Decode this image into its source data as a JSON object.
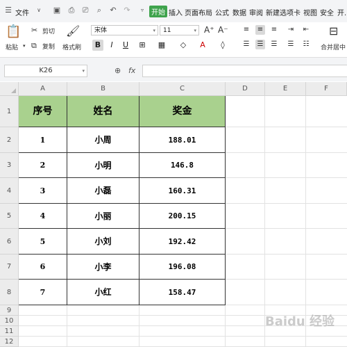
{
  "menubar": {
    "file_label": "文件",
    "tabs": [
      "开始",
      "插入",
      "页面布局",
      "公式",
      "数据",
      "审阅",
      "新建选项卡",
      "视图",
      "安全",
      "开..."
    ]
  },
  "ribbon": {
    "paste_label": "粘贴",
    "cut_label": "剪切",
    "copy_label": "复制",
    "format_painter_label": "格式刷",
    "font_name": "宋体",
    "font_size": "11",
    "merge_label": "合并居中"
  },
  "formula_bar": {
    "name_box": "K26",
    "fx_label": "fx",
    "formula": ""
  },
  "grid": {
    "columns": [
      "A",
      "B",
      "C",
      "D",
      "E",
      "F"
    ],
    "rows": [
      "1",
      "2",
      "3",
      "4",
      "5",
      "6",
      "7",
      "8",
      "9",
      "10",
      "11",
      "12"
    ]
  },
  "table": {
    "headers": [
      "序号",
      "姓名",
      "奖金"
    ],
    "rows": [
      [
        "1",
        "小周",
        "188.01"
      ],
      [
        "2",
        "小明",
        "146.8"
      ],
      [
        "3",
        "小磊",
        "160.31"
      ],
      [
        "4",
        "小丽",
        "200.15"
      ],
      [
        "5",
        "小刘",
        "192.42"
      ],
      [
        "6",
        "小李",
        "196.08"
      ],
      [
        "7",
        "小红",
        "158.47"
      ]
    ]
  },
  "watermark": "Baidu 经验",
  "colors": {
    "header_fill": "#a9d18e",
    "active_tab": "#3fa34d"
  }
}
